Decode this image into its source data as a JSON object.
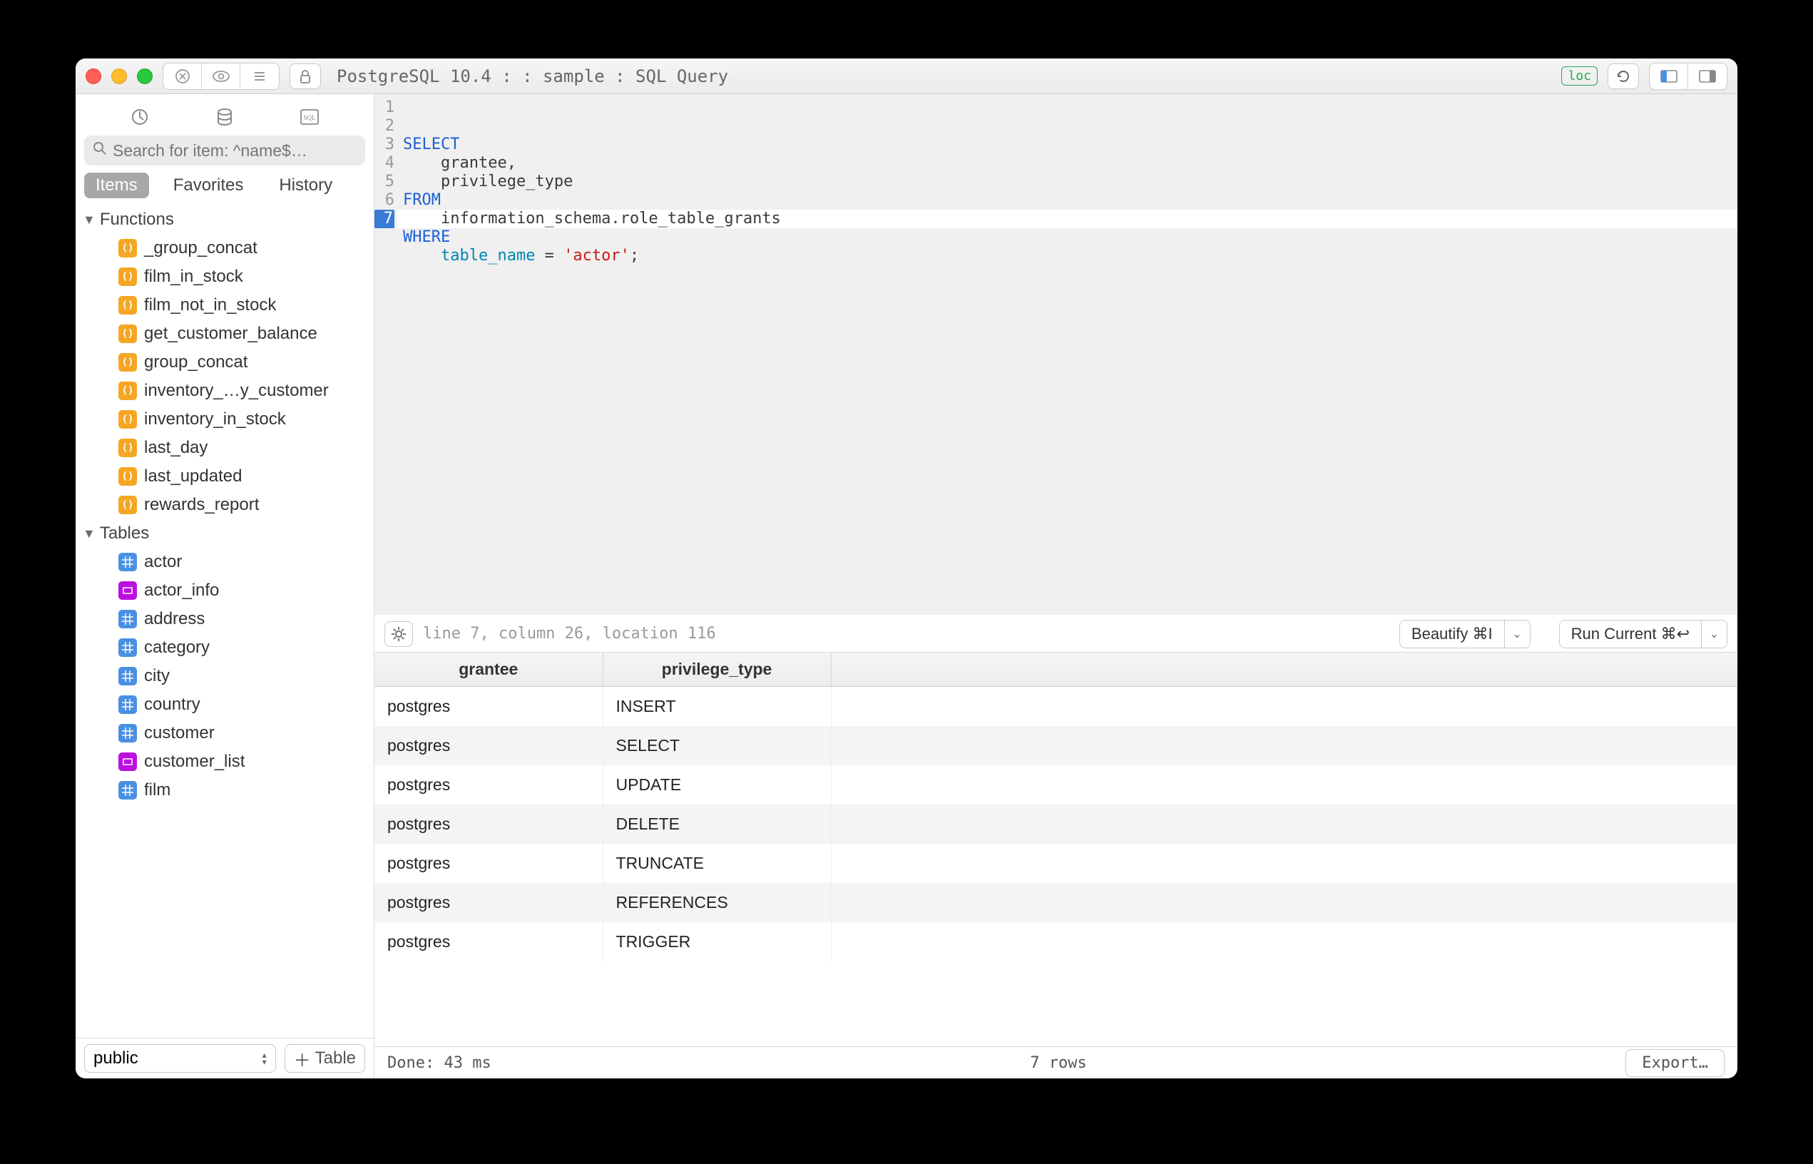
{
  "window": {
    "title": "PostgreSQL 10.4 :  : sample : SQL Query"
  },
  "titlebar": {
    "loc_badge": "loc"
  },
  "sidebar": {
    "search_placeholder": "Search for item: ^name$…",
    "tabs": [
      "Items",
      "Favorites",
      "History"
    ],
    "active_tab": 0,
    "functions_header": "Functions",
    "tables_header": "Tables",
    "functions": [
      "_group_concat",
      "film_in_stock",
      "film_not_in_stock",
      "get_customer_balance",
      "group_concat",
      "inventory_…y_customer",
      "inventory_in_stock",
      "last_day",
      "last_updated",
      "rewards_report"
    ],
    "tables": [
      {
        "name": "actor",
        "type": "table"
      },
      {
        "name": "actor_info",
        "type": "view"
      },
      {
        "name": "address",
        "type": "table"
      },
      {
        "name": "category",
        "type": "table"
      },
      {
        "name": "city",
        "type": "table"
      },
      {
        "name": "country",
        "type": "table"
      },
      {
        "name": "customer",
        "type": "table"
      },
      {
        "name": "customer_list",
        "type": "view"
      },
      {
        "name": "film",
        "type": "table"
      }
    ],
    "schema": "public",
    "add_table": "Table"
  },
  "editor": {
    "lines": {
      "l1_kw": "SELECT",
      "l2": "    grantee,",
      "l3": "    privilege_type",
      "l4_kw": "FROM",
      "l5": "    information_schema.role_table_grants",
      "l6_kw": "WHERE",
      "l7_col": "table_name",
      "l7_eq": " = ",
      "l7_str": "'actor'",
      "l7_semi": ";"
    },
    "gutter": [
      "1",
      "2",
      "3",
      "4",
      "5",
      "6",
      "7"
    ],
    "current_line": 7
  },
  "toolbar": {
    "location": "line 7, column 26, location 116",
    "beautify": "Beautify ⌘I",
    "run": "Run Current ⌘↩"
  },
  "results": {
    "columns": [
      "grantee",
      "privilege_type"
    ],
    "rows": [
      [
        "postgres",
        "INSERT"
      ],
      [
        "postgres",
        "SELECT"
      ],
      [
        "postgres",
        "UPDATE"
      ],
      [
        "postgres",
        "DELETE"
      ],
      [
        "postgres",
        "TRUNCATE"
      ],
      [
        "postgres",
        "REFERENCES"
      ],
      [
        "postgres",
        "TRIGGER"
      ]
    ]
  },
  "status": {
    "done": "Done: 43 ms",
    "rows": "7 rows",
    "export": "Export…"
  }
}
